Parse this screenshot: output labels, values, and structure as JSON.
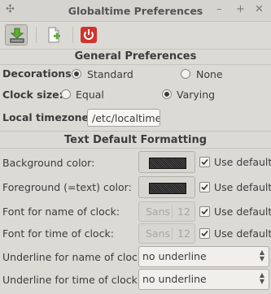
{
  "window": {
    "title": "Globaltime Preferences"
  },
  "general": {
    "heading": "General Preferences",
    "decorations": {
      "label": "Decorations:",
      "options": [
        "Standard",
        "None"
      ],
      "selected": "Standard"
    },
    "clock_size": {
      "label": "Clock size:",
      "options": [
        "Equal",
        "Varying"
      ],
      "selected": "Varying"
    },
    "local_timezone": {
      "label": "Local timezone:",
      "value": "/etc/localtime"
    }
  },
  "text_format": {
    "heading": "Text Default Formatting",
    "background_color": {
      "label": "Background color:",
      "use_default_label": "Use default",
      "use_default": true,
      "swatch": "#222222"
    },
    "foreground_color": {
      "label": "Foreground (=text) color:",
      "use_default_label": "Use default",
      "use_default": true,
      "swatch": "#222222"
    },
    "font_name": {
      "label": "Font for name of clock:",
      "font": "Sans",
      "size": "12",
      "use_default_label": "Use default",
      "use_default": true
    },
    "font_time": {
      "label": "Font for time of clock:",
      "font": "Sans",
      "size": "12",
      "use_default_label": "Use default",
      "use_default": true
    },
    "underline_name": {
      "label": "Underline for name of clock:",
      "value": "no underline"
    },
    "underline_time": {
      "label": "Underline for time of clock:",
      "value": "no underline"
    }
  }
}
